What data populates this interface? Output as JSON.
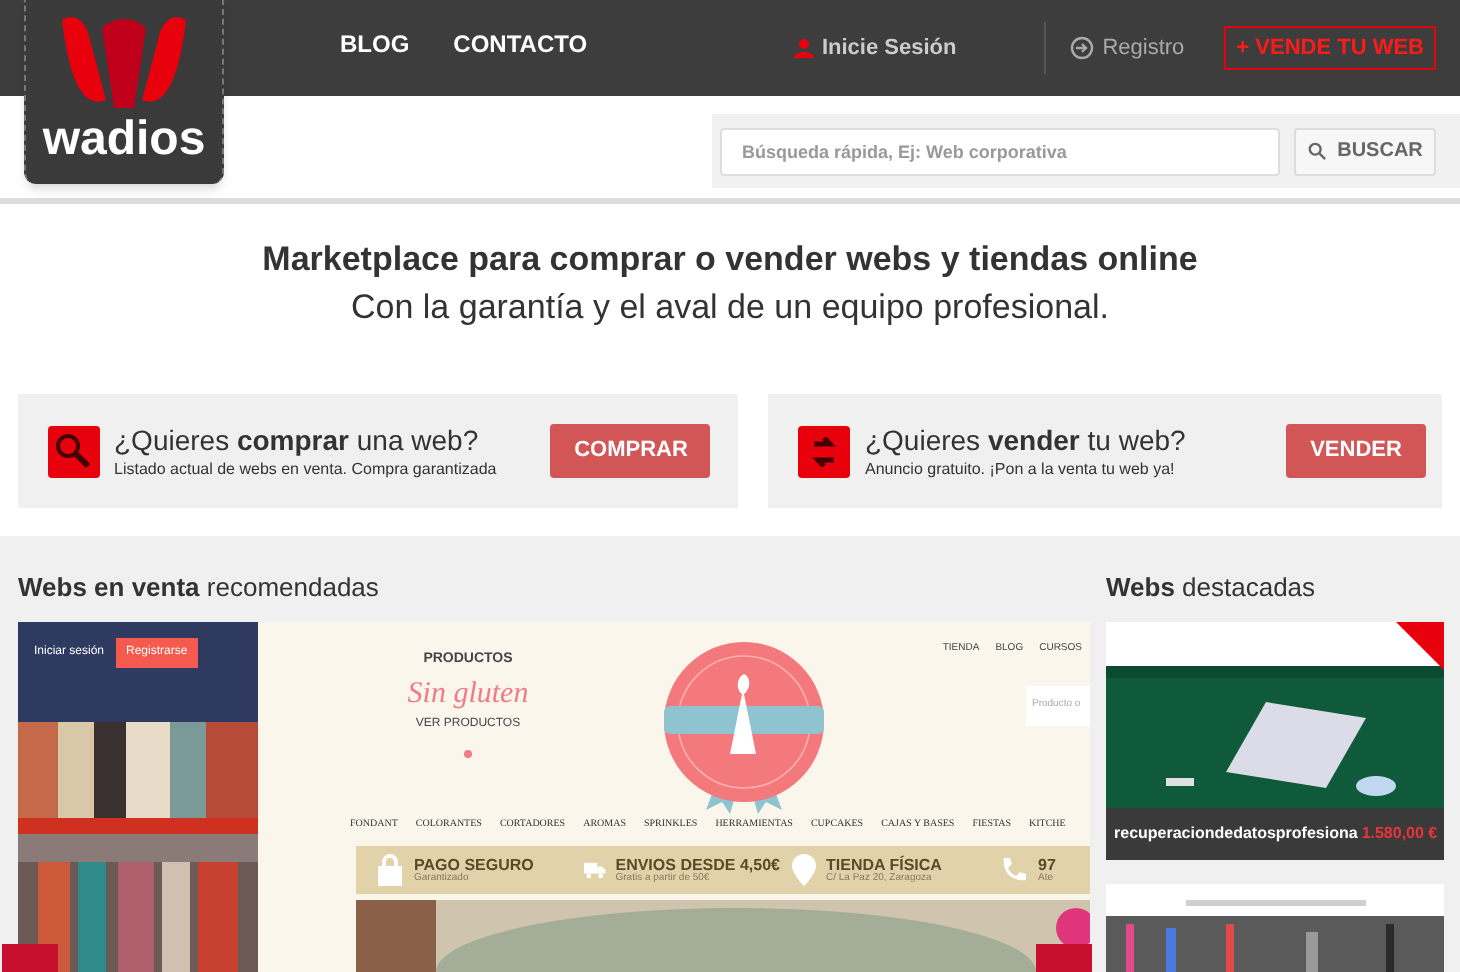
{
  "header": {
    "logo": "wadios",
    "nav": [
      "BLOG",
      "CONTACTO"
    ],
    "login": "Inicie Sesión",
    "register": "Registro",
    "sell_button": "+ VENDE TU WEB"
  },
  "search": {
    "placeholder": "Búsqueda rápida, Ej: Web corporativa",
    "button": "BUSCAR"
  },
  "hero": {
    "title": "Marketplace para comprar o vender webs y tiendas online",
    "subtitle": "Con la garantía y el aval de un equipo profesional."
  },
  "cards": [
    {
      "kind": "buy",
      "title": "¿Quieres **comprar** una web?",
      "text": "Listado actual de webs en venta. Compra garantizada",
      "button": "COMPRAR"
    },
    {
      "kind": "sell",
      "title": "¿Quieres **vender** tu web?",
      "text": "Anuncio gratuito. ¡Pon a la venta tu web ya!",
      "button": "VENDER"
    }
  ],
  "recommended": {
    "heading": "**Webs en venta** recomendadas",
    "preview": {
      "login": "Iniciar sesión",
      "register": "Registrarse",
      "products_label": "PRODUCTOS",
      "products_title": "Sin gluten",
      "products_link": "VER PRODUCTOS",
      "top_nav": [
        "TIENDA",
        "BLOG",
        "CURSOS"
      ],
      "search_placeholder": "Producto o",
      "categories": [
        "FONDANT",
        "COLORANTES",
        "CORTADORES",
        "AROMAS",
        "SPRINKLES",
        "HERRAMIENTAS",
        "CUPCAKES",
        "CAJAS Y BASES",
        "FIESTAS",
        "KITCHE"
      ],
      "features": [
        {
          "kind": "lock",
          "title": "PAGO SEGURO",
          "text": "Garantizado"
        },
        {
          "kind": "truck",
          "title": "ENVIOS DESDE 4,50€",
          "text": "Gratis a partir de 50€"
        },
        {
          "kind": "pin",
          "title": "TIENDA FÍSICA",
          "text": "C/ La Paz 20, Zaragoza"
        },
        {
          "kind": "phone",
          "title": "97",
          "text": "Ate"
        }
      ]
    }
  },
  "featured": {
    "heading": "**Webs** destacadas",
    "items": [
      {
        "name": "recuperaciondedatosprofesiona",
        "price": "1.580,00 €"
      }
    ]
  }
}
